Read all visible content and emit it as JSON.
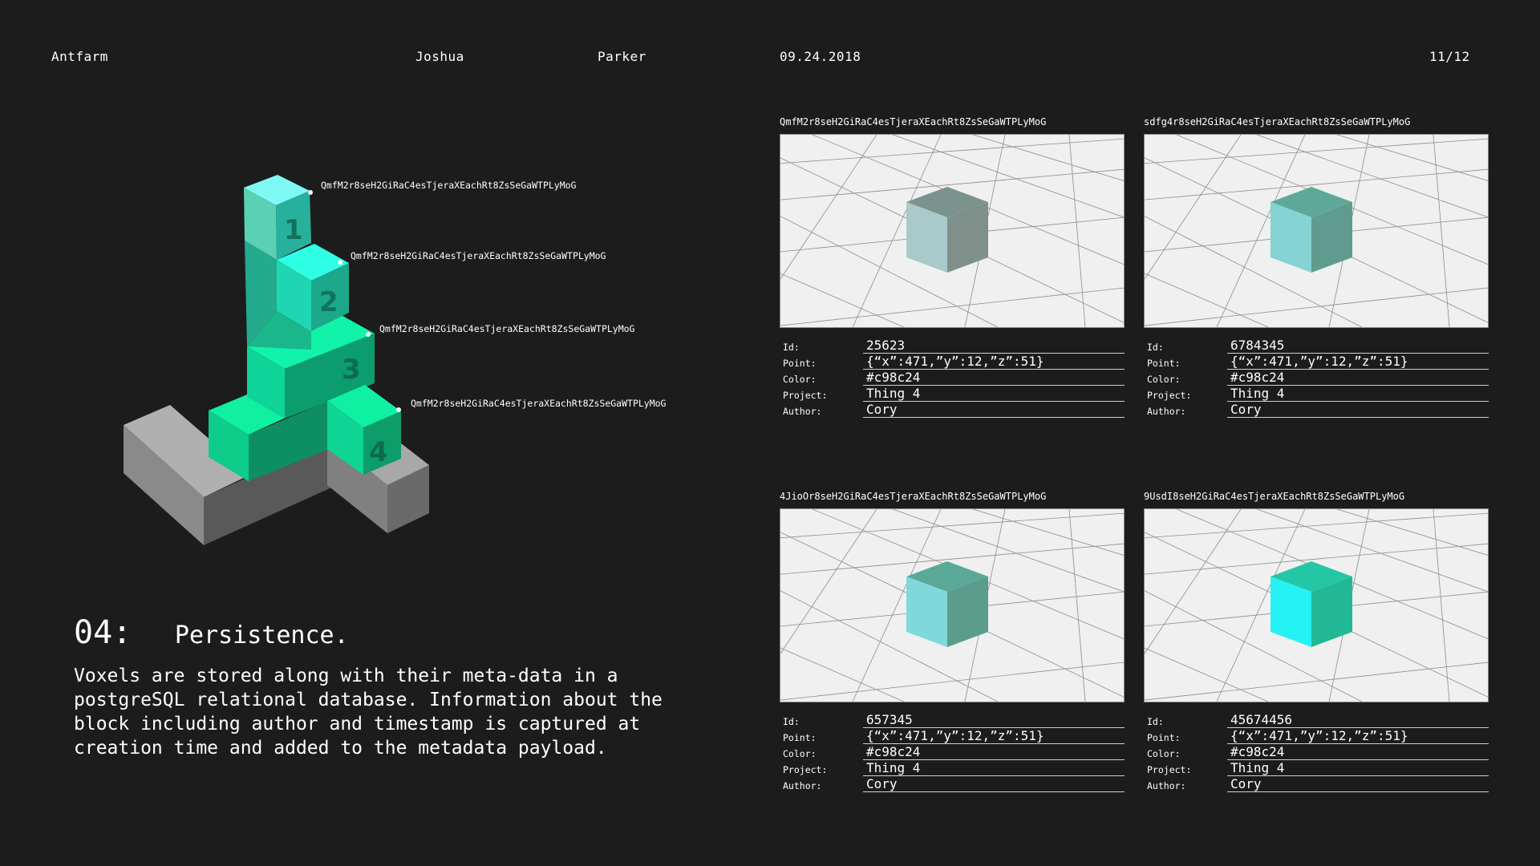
{
  "header": {
    "brand": "Antfarm",
    "first_name": "Joshua",
    "last_name": "Parker",
    "date": "09.24.2018",
    "page": "11/12"
  },
  "voxel_labels": [
    "QmfM2r8seH2GiRaC4esTjeraXEachRt8ZsSeGaWTPLyMoG",
    "QmfM2r8seH2GiRaC4esTjeraXEachRt8ZsSeGaWTPLyMoG",
    "QmfM2r8seH2GiRaC4esTjeraXEachRt8ZsSeGaWTPLyMoG",
    "QmfM2r8seH2GiRaC4esTjeraXEachRt8ZsSeGaWTPLyMoG"
  ],
  "voxel_numbers": [
    "1",
    "2",
    "3",
    "4"
  ],
  "section": {
    "number": "04:",
    "title": "Persistence.",
    "body": "Voxels are stored along with their meta-data in a\npostgreSQL relational database. Information about the\nblock including author and timestamp is captured at\ncreation time and added to the metadata payload."
  },
  "meta_labels": {
    "id": "Id:",
    "point": "Point:",
    "color": "Color:",
    "project": "Project:",
    "author": "Author:"
  },
  "cards": [
    {
      "hash": "QmfM2r8seH2GiRaC4esTjeraXEachRt8ZsSeGaWTPLyMoG",
      "id": "25623",
      "point": "{“x”:471,”y”:12,”z”:51}",
      "color": "#c98c24",
      "project": "Thing 4",
      "author": "Cory",
      "cube_colors": {
        "top": "#7a938d",
        "left": "#aac9cb",
        "right": "#7f8f8a"
      }
    },
    {
      "hash": "sdfg4r8seH2GiRaC4esTjeraXEachRt8ZsSeGaWTPLyMoG",
      "id": "6784345",
      "point": "{“x”:471,”y”:12,”z”:51}",
      "color": "#c98c24",
      "project": "Thing 4",
      "author": "Cory",
      "cube_colors": {
        "top": "#5fa898",
        "left": "#85d3d3",
        "right": "#5f9c8d"
      }
    },
    {
      "hash": "4JioOr8seH2GiRaC4esTjeraXEachRt8ZsSeGaWTPLyMoG",
      "id": "657345",
      "point": "{“x”:471,”y”:12,”z”:51}",
      "color": "#c98c24",
      "project": "Thing 4",
      "author": "Cory",
      "cube_colors": {
        "top": "#5aa896",
        "left": "#7fd9da",
        "right": "#5b9c8b"
      }
    },
    {
      "hash": "9UsdI8seH2GiRaC4esTjeraXEachRt8ZsSeGaWTPLyMoG",
      "id": "45674456",
      "point": "{“x”:471,”y”:12,”z”:51}",
      "color": "#c98c24",
      "project": "Thing 4",
      "author": "Cory",
      "cube_colors": {
        "top": "#24c7a4",
        "left": "#25f2f4",
        "right": "#22b895"
      }
    }
  ]
}
